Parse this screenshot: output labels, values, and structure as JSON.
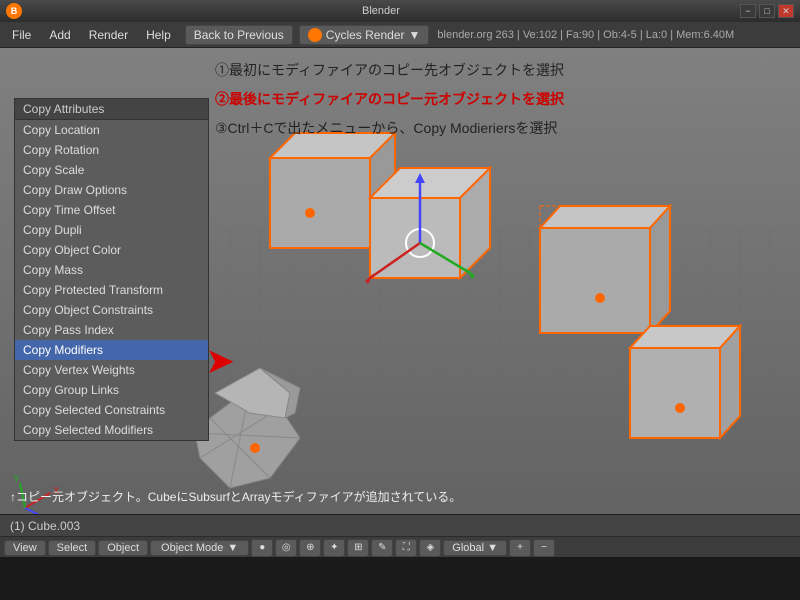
{
  "titlebar": {
    "logo": "B",
    "title": "Blender",
    "min_label": "−",
    "max_label": "□",
    "close_label": "✕"
  },
  "menubar": {
    "items": [
      "File",
      "Add",
      "Render",
      "Help"
    ],
    "back_btn": "Back to Previous",
    "engine": "Cycles Render",
    "info": "blender.org 263 | Ve:102 | Fa:90 | Ob:4-5 | La:0 | Mem:6.40M"
  },
  "dropdown": {
    "header": "Copy Attributes",
    "items": [
      {
        "label": "Copy Location",
        "selected": false
      },
      {
        "label": "Copy Rotation",
        "selected": false
      },
      {
        "label": "Copy Scale",
        "selected": false
      },
      {
        "label": "Copy Draw Options",
        "selected": false
      },
      {
        "label": "Copy Time Offset",
        "selected": false
      },
      {
        "label": "Copy Dupli",
        "selected": false
      },
      {
        "label": "Copy Object Color",
        "selected": false
      },
      {
        "label": "Copy Mass",
        "selected": false
      },
      {
        "label": "Copy Protected Transform",
        "selected": false
      },
      {
        "label": "Copy Object Constraints",
        "selected": false
      },
      {
        "label": "Copy Pass Index",
        "selected": false
      },
      {
        "label": "Copy Modifiers",
        "selected": true
      },
      {
        "label": "Copy Vertex Weights",
        "selected": false
      },
      {
        "label": "Copy Group Links",
        "selected": false
      },
      {
        "label": "Copy Selected Constraints",
        "selected": false
      },
      {
        "label": "Copy Selected Modifiers",
        "selected": false
      }
    ]
  },
  "annotations": {
    "line1": "①最初にモディファイアのコピー先オブジェクトを選択",
    "line2": "②最後にモディファイアのコピー元オブジェクトを選択",
    "line3": "③Ctrl＋Cで出たメニューから、Copy Modieriersを選択"
  },
  "viewport_text": "↑コピー元オブジェクト。CubeにSubsurfとArrayモディファイアが追加されている。",
  "statusbar": {
    "view": "View",
    "select": "Select",
    "object": "Object",
    "mode": "Object Mode",
    "global": "Global",
    "obj_label": "(1) Cube.003"
  }
}
